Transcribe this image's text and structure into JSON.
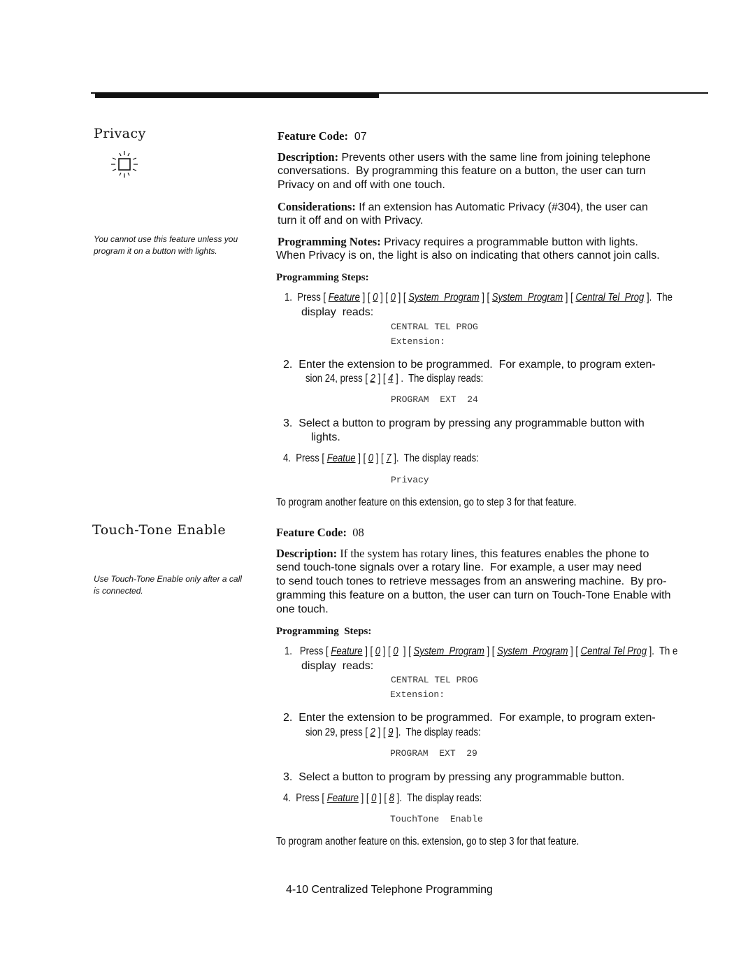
{
  "privacy": {
    "title": "Privacy",
    "icon": "light-on-icon",
    "note": "You cannot use this feature unless you program it on a button with lights.",
    "feature_code": [
      [
        "b",
        "Feature Code:"
      ],
      [
        "t",
        "  07"
      ]
    ],
    "description": [
      [
        [
          "b",
          "Description:"
        ],
        [
          "t",
          " Prevents other users with the same line from joining telephone"
        ]
      ],
      [
        [
          "t",
          "conversations.  By programming this feature on a button, the user can turn"
        ]
      ],
      [
        [
          "t",
          "Privacy on and off with one touch."
        ]
      ]
    ],
    "considerations": [
      [
        [
          "b",
          "Considerations:"
        ],
        [
          "t",
          " If an extension has Automatic Privacy (#304), the user can"
        ]
      ],
      [
        [
          "t",
          "turn it off and on with Privacy."
        ]
      ]
    ],
    "programming_notes": [
      [
        [
          "b",
          "Programming Notes:"
        ],
        [
          "t",
          " Privacy requires a programmable button with lights."
        ]
      ],
      [
        [
          "t",
          "When Privacy is on, the light is also on indicating that others cannot join calls."
        ]
      ]
    ],
    "steps_heading": [
      [
        "h",
        "Programming Steps:"
      ]
    ],
    "step1": [
      [
        "c",
        "1.  Press [ "
      ],
      [
        "k",
        "Feature"
      ],
      [
        "c",
        " ] [ "
      ],
      [
        "k",
        "0"
      ],
      [
        "c",
        " ] [ "
      ],
      [
        "k",
        "0"
      ],
      [
        "c",
        " ] [ "
      ],
      [
        "k",
        "System  Program"
      ],
      [
        "c",
        " ] [ "
      ],
      [
        "k",
        "System  Program"
      ],
      [
        "c",
        " ] [ "
      ],
      [
        "k",
        "Central Tel  Prog"
      ],
      [
        "c",
        " ].  The"
      ]
    ],
    "step1_cont": [
      [
        "t",
        "display  reads:"
      ]
    ],
    "display1": [
      [
        [
          "m",
          "CENTRAL TEL PROG"
        ]
      ],
      [
        [
          "m",
          "Extension:"
        ]
      ]
    ],
    "step2": [
      [
        "t",
        "2.  Enter the extension to be programmed.  For example, to program exten-"
      ]
    ],
    "step2_cont": [
      [
        "c",
        "sion 24, press [ "
      ],
      [
        "k",
        "2"
      ],
      [
        "c",
        " ] [ "
      ],
      [
        "k",
        "4"
      ],
      [
        "c",
        " ] .  The display reads:"
      ]
    ],
    "display2": [
      [
        "m",
        "PROGRAM  EXT  24"
      ]
    ],
    "step3": [
      [
        "t",
        "3.  Select a button to program by pressing any programmable button with"
      ]
    ],
    "step3_cont": [
      [
        "t",
        "lights."
      ]
    ],
    "step4": [
      [
        "c",
        "4.  Press [ "
      ],
      [
        "k",
        "Featue"
      ],
      [
        "c",
        " ] [ "
      ],
      [
        "k",
        "0"
      ],
      [
        "c",
        " ] [ "
      ],
      [
        "k",
        "7"
      ],
      [
        "c",
        " ].  The display reads:"
      ]
    ],
    "display4": [
      [
        "m",
        "Privacy"
      ]
    ],
    "closing": [
      [
        "c",
        "To program another feature on this extension, go to step 3 for that feature."
      ]
    ]
  },
  "touch_tone": {
    "title": "Touch-Tone  Enable",
    "note": "Use Touch-Tone Enable only after a call is connected.",
    "feature_code": [
      [
        "b",
        "Feature Code:"
      ],
      [
        "s",
        "  08"
      ]
    ],
    "description": [
      [
        [
          "b",
          "Description:"
        ],
        [
          "s",
          " If the system has rotary"
        ],
        [
          "t",
          " lines, this features enables the phone to"
        ]
      ],
      [
        [
          "t",
          "send touch-tone signals over a rotary line.  For example, a user may need"
        ]
      ],
      [
        [
          "t",
          "to send touch tones to retrieve messages from an answering machine.  By pro-"
        ]
      ],
      [
        [
          "t",
          "gramming this feature on a button, the user can turn on Touch-Tone Enable with"
        ]
      ],
      [
        [
          "t",
          "one touch."
        ]
      ]
    ],
    "steps_heading": [
      [
        "h",
        "Programming  Steps:"
      ]
    ],
    "step1": [
      [
        "c",
        "1.   Press [ "
      ],
      [
        "k",
        "Feature"
      ],
      [
        "c",
        " ] [ "
      ],
      [
        "k",
        "0"
      ],
      [
        "c",
        " ] [ "
      ],
      [
        "k",
        "0"
      ],
      [
        "c",
        "  ] [ "
      ],
      [
        "k",
        "System  Program"
      ],
      [
        "c",
        " ] [ "
      ],
      [
        "k",
        "System  Program"
      ],
      [
        "c",
        " ] [ "
      ],
      [
        "k",
        "Central Tel Prog"
      ],
      [
        "c",
        " ].  Th e"
      ]
    ],
    "step1_cont": [
      [
        "t",
        "display  reads:"
      ]
    ],
    "display1": [
      [
        [
          "m",
          "CENTRAL TEL PROG"
        ]
      ],
      [
        [
          "m",
          "Extension:"
        ]
      ]
    ],
    "step2": [
      [
        "t",
        "2.  Enter the extension to be programmed.  For example, to program exten-"
      ]
    ],
    "step2_cont": [
      [
        "c",
        "sion 29, press [ "
      ],
      [
        "k",
        "2"
      ],
      [
        "c",
        " ] [ "
      ],
      [
        "k",
        "9"
      ],
      [
        "c",
        " ].  The display reads:"
      ]
    ],
    "display2": [
      [
        "m",
        "PROGRAM  EXT  29"
      ]
    ],
    "step3": [
      [
        "t",
        "3.  Select a button to program by pressing any programmable button."
      ]
    ],
    "step4": [
      [
        "c",
        "4.  Press [ "
      ],
      [
        "k",
        "Feature"
      ],
      [
        "c",
        " ] [ "
      ],
      [
        "k",
        "0"
      ],
      [
        "c",
        " ] [ "
      ],
      [
        "k",
        "8"
      ],
      [
        "c",
        " ].  The display reads:"
      ]
    ],
    "display4": [
      [
        "m",
        "TouchTone  Enable"
      ]
    ],
    "closing": [
      [
        "c",
        "To program another feature on this. extension, go to step 3 for that feature."
      ]
    ]
  },
  "footer": "4-10  Centralized Telephone Programming"
}
